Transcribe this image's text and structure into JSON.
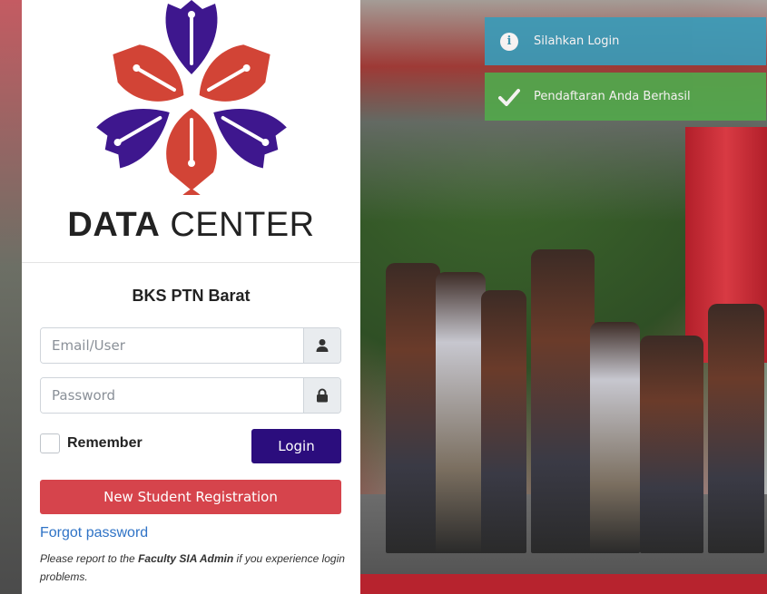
{
  "brand": {
    "title_bold": "DATA",
    "title_rest": "CENTER",
    "logo_colors": {
      "purple": "#3e178e",
      "red": "#d24436"
    }
  },
  "org_name": "BKS PTN Barat",
  "form": {
    "email_placeholder": "Email/User",
    "password_placeholder": "Password",
    "remember_label": "Remember",
    "login_label": "Login",
    "register_label": "New Student Registration",
    "forgot_label": "Forgot password",
    "note_before": "Please report to the ",
    "note_bold": "Faculty SIA Admin",
    "note_after": " if you experience login problems."
  },
  "toasts": [
    {
      "type": "info",
      "icon": "info-icon",
      "message": "Silahkan Login",
      "color": "#3a9bb8"
    },
    {
      "type": "success",
      "icon": "check-icon",
      "message": "Pendaftaran Anda Berhasil",
      "color": "#52a84c"
    }
  ],
  "colors": {
    "login_button": "#2b0d7d",
    "register_button": "#d6444c",
    "link": "#2f73c6"
  }
}
